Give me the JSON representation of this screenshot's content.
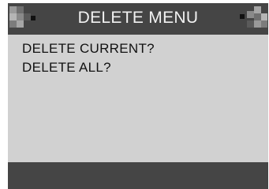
{
  "header": {
    "title": "DELETE MENU"
  },
  "menu": {
    "items": [
      {
        "label": "DELETE CURRENT?",
        "selected": false
      },
      {
        "label": "DELETE ALL?",
        "selected": true
      }
    ]
  },
  "colors": {
    "title_bar": "#454545",
    "screen_bg": "#d1d1d1",
    "text": "#111111",
    "title_text": "#f2f2f2"
  },
  "icons": {
    "cursor": "triangle-right-outline-icon",
    "left_decoration": "pixel-blocks-icon",
    "right_decoration": "pixel-blocks-icon"
  }
}
